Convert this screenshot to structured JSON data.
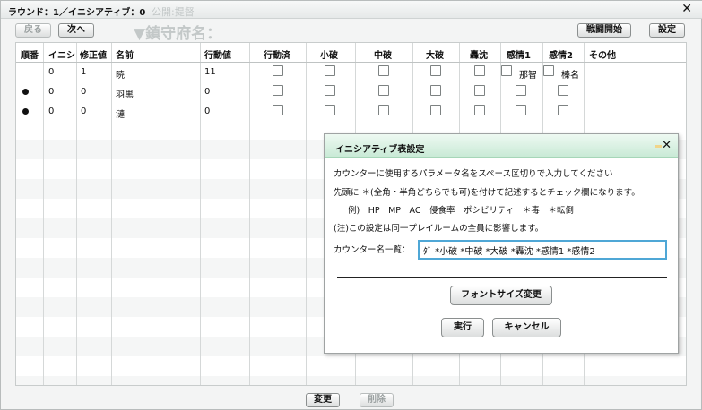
{
  "window": {
    "title": "ラウンド：1／イニシアティブ：0",
    "bg_ghost_1": "公開:提督",
    "bg_ghost_2": "▼鎮守府名："
  },
  "toolbar": {
    "back_label": "戻る",
    "next_label": "次へ",
    "battle_start_label": "戦闘開始",
    "settings_label": "設定"
  },
  "table": {
    "headers": [
      "順番",
      "イニシ",
      "修正値",
      "名前",
      "行動値",
      "行動済",
      "小破",
      "中破",
      "大破",
      "轟沈",
      "感情1",
      "感情2",
      "その他"
    ],
    "rows": [
      {
        "order": "",
        "initiative": "0",
        "modifier": "1",
        "name": "暁",
        "action": "11",
        "emotion1_label": "那智",
        "emotion2_label": "榛名"
      },
      {
        "order": "●",
        "initiative": "0",
        "modifier": "0",
        "name": "羽黒",
        "action": "0",
        "emotion1_label": "",
        "emotion2_label": ""
      },
      {
        "order": "●",
        "initiative": "0",
        "modifier": "0",
        "name": "漣",
        "action": "0",
        "emotion1_label": "",
        "emotion2_label": ""
      }
    ]
  },
  "bottom": {
    "change_label": "変更",
    "delete_label": "削除"
  },
  "dialog": {
    "title": "イニシアティブ表設定",
    "line1": "カウンターに使用するパラメータ名をスペース区切りで入力してください",
    "line2": "先頭に ＊(全角・半角どちらでも可)を付けて記述するとチェック欄になります。",
    "line3": "例)　HP　MP　AC　侵食率　ポシビリティ　＊毒　＊転倒",
    "line4": "(注)この設定は同一プレイルームの全員に影響します。",
    "counter_label": "カウンター名一覧：",
    "counter_value": "ﾀﾞ *小破 *中破 *大破 *轟沈 *感情1 *感情2",
    "font_size_button": "フォントサイズ変更",
    "execute_button": "実行",
    "cancel_button": "キャンセル"
  },
  "colors": {
    "dialog_title_bg": "#c9ead6",
    "input_border": "#4fa7d6"
  }
}
